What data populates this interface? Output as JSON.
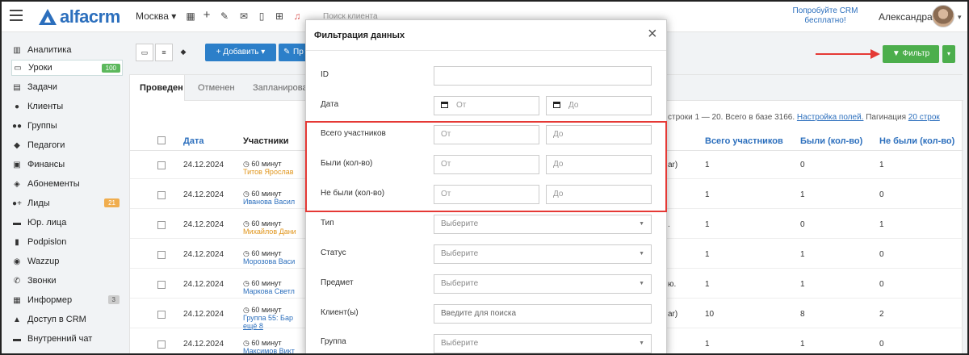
{
  "topbar": {
    "logo_text": "alfacrm",
    "city": "Москва ▾",
    "client_search_placeholder": "Поиск клиента",
    "promo": "Попробуйте CRM бесплатно!",
    "user_name": "Александра",
    "icons": [
      "plus-icon",
      "wrench-icon",
      "mail-icon",
      "mobile-icon",
      "cart-icon",
      "bell-icon"
    ]
  },
  "sidebar": {
    "items": [
      {
        "label": "Аналитика",
        "icon": "analytics-icon"
      },
      {
        "label": "Уроки",
        "icon": "lessons-icon",
        "badge": "100"
      },
      {
        "label": "Задачи",
        "icon": "tasks-icon"
      },
      {
        "label": "Клиенты",
        "icon": "client-icon"
      },
      {
        "label": "Группы",
        "icon": "groups-icon"
      },
      {
        "label": "Педагоги",
        "icon": "teacher-icon"
      },
      {
        "label": "Финансы",
        "icon": "finance-icon"
      },
      {
        "label": "Абонементы",
        "icon": "ticket-icon"
      },
      {
        "label": "Лиды",
        "icon": "leads-icon",
        "badge": "21"
      },
      {
        "label": "Юр. лица",
        "icon": "briefcase-icon"
      },
      {
        "label": "Podpislon",
        "icon": "document-icon"
      },
      {
        "label": "Wazzup",
        "icon": "whatsapp-icon"
      },
      {
        "label": "Звонки",
        "icon": "phone-icon"
      },
      {
        "label": "Информер",
        "icon": "informer-icon",
        "badge": "3"
      },
      {
        "label": "Доступ в CRM",
        "icon": "lock-icon"
      },
      {
        "label": "Внутренний чат",
        "icon": "chat-icon"
      }
    ]
  },
  "toolbar": {
    "add_label": "+ Добавить ▾",
    "p_label": "Пр",
    "filter_label": "▼ Фильтр",
    "filter_caret": "▾"
  },
  "tabs": [
    "Проведен",
    "Отменен",
    "Запланирован"
  ],
  "pager": {
    "rows_text": "строки 1 — 20. Всего в базе 3166.",
    "settings_link": "Настройка полей.",
    "pagination_label": "Пагинация",
    "pagination_link": "20 строк"
  },
  "table": {
    "headers": {
      "date": "Дата",
      "participants": "Участники",
      "total": "Всего участников",
      "present": "Были (кол-во)",
      "absent": "Не были (кол-во)"
    },
    "rows": [
      {
        "date": "24.12.2024",
        "duration": "◷ 60 минут",
        "name": "Титов Ярослав",
        "name_color": "orange",
        "suffix": "ar)",
        "total": "1",
        "present": "0",
        "absent": "1"
      },
      {
        "date": "24.12.2024",
        "duration": "◷ 60 минут",
        "name": "Иванова Васил",
        "name_color": "blue",
        "suffix": "",
        "total": "1",
        "present": "1",
        "absent": "0"
      },
      {
        "date": "24.12.2024",
        "duration": "◷ 60 минут",
        "name": "Михайлов Дани",
        "name_color": "orange",
        "suffix": ".",
        "total": "1",
        "present": "0",
        "absent": "1"
      },
      {
        "date": "24.12.2024",
        "duration": "◷ 60 минут",
        "name": "Морозова Васи",
        "name_color": "blue",
        "suffix": "",
        "total": "1",
        "present": "1",
        "absent": "0"
      },
      {
        "date": "24.12.2024",
        "duration": "◷ 60 минут",
        "name": "Маркова Светл",
        "name_color": "blue",
        "suffix": "ю.",
        "total": "1",
        "present": "1",
        "absent": "0"
      },
      {
        "date": "24.12.2024",
        "duration": "◷ 60 минут",
        "name": "Группа 55: Бар",
        "name_color": "blue",
        "extra": "ещё 8",
        "suffix": "ar)",
        "total": "10",
        "present": "8",
        "absent": "2"
      },
      {
        "date": "24.12.2024",
        "duration": "◷ 60 минут",
        "name": "Максимов Викт",
        "name_color": "blue",
        "suffix": "",
        "total": "1",
        "present": "1",
        "absent": "0"
      }
    ]
  },
  "modal": {
    "title": "Фильтрация данных",
    "close": "×",
    "fields": {
      "id_label": "ID",
      "date_label": "Дата",
      "date_from": "От",
      "date_to": "До",
      "total_label": "Всего участников",
      "present_label": "Были (кол-во)",
      "absent_label": "Не были (кол-во)",
      "from_placeholder": "От",
      "to_placeholder": "До",
      "type_label": "Тип",
      "status_label": "Статус",
      "subject_label": "Предмет",
      "clients_label": "Клиент(ы)",
      "group_label": "Группа",
      "select_placeholder": "Выберите",
      "search_placeholder": "Введите для поиска"
    }
  },
  "colors": {
    "accent_blue": "#2c6fbd",
    "add_button": "#2c7fc9",
    "filter_button": "#4cae4c",
    "highlight_red": "#e53935"
  }
}
